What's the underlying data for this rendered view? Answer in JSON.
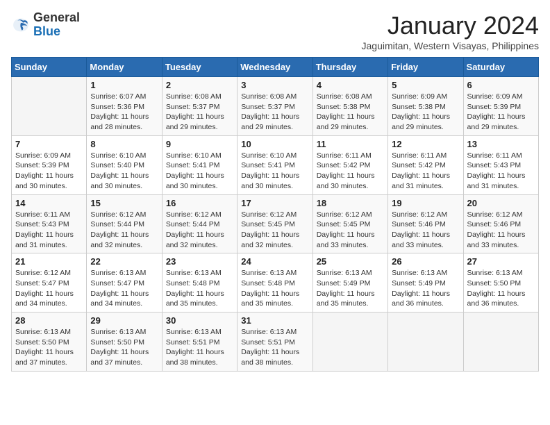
{
  "header": {
    "logo_general": "General",
    "logo_blue": "Blue",
    "month_title": "January 2024",
    "subtitle": "Jaguimitan, Western Visayas, Philippines"
  },
  "days_of_week": [
    "Sunday",
    "Monday",
    "Tuesday",
    "Wednesday",
    "Thursday",
    "Friday",
    "Saturday"
  ],
  "weeks": [
    [
      {
        "day": "",
        "info": ""
      },
      {
        "day": "1",
        "info": "Sunrise: 6:07 AM\nSunset: 5:36 PM\nDaylight: 11 hours\nand 28 minutes."
      },
      {
        "day": "2",
        "info": "Sunrise: 6:08 AM\nSunset: 5:37 PM\nDaylight: 11 hours\nand 29 minutes."
      },
      {
        "day": "3",
        "info": "Sunrise: 6:08 AM\nSunset: 5:37 PM\nDaylight: 11 hours\nand 29 minutes."
      },
      {
        "day": "4",
        "info": "Sunrise: 6:08 AM\nSunset: 5:38 PM\nDaylight: 11 hours\nand 29 minutes."
      },
      {
        "day": "5",
        "info": "Sunrise: 6:09 AM\nSunset: 5:38 PM\nDaylight: 11 hours\nand 29 minutes."
      },
      {
        "day": "6",
        "info": "Sunrise: 6:09 AM\nSunset: 5:39 PM\nDaylight: 11 hours\nand 29 minutes."
      }
    ],
    [
      {
        "day": "7",
        "info": "Sunrise: 6:09 AM\nSunset: 5:39 PM\nDaylight: 11 hours\nand 30 minutes."
      },
      {
        "day": "8",
        "info": "Sunrise: 6:10 AM\nSunset: 5:40 PM\nDaylight: 11 hours\nand 30 minutes."
      },
      {
        "day": "9",
        "info": "Sunrise: 6:10 AM\nSunset: 5:41 PM\nDaylight: 11 hours\nand 30 minutes."
      },
      {
        "day": "10",
        "info": "Sunrise: 6:10 AM\nSunset: 5:41 PM\nDaylight: 11 hours\nand 30 minutes."
      },
      {
        "day": "11",
        "info": "Sunrise: 6:11 AM\nSunset: 5:42 PM\nDaylight: 11 hours\nand 30 minutes."
      },
      {
        "day": "12",
        "info": "Sunrise: 6:11 AM\nSunset: 5:42 PM\nDaylight: 11 hours\nand 31 minutes."
      },
      {
        "day": "13",
        "info": "Sunrise: 6:11 AM\nSunset: 5:43 PM\nDaylight: 11 hours\nand 31 minutes."
      }
    ],
    [
      {
        "day": "14",
        "info": "Sunrise: 6:11 AM\nSunset: 5:43 PM\nDaylight: 11 hours\nand 31 minutes."
      },
      {
        "day": "15",
        "info": "Sunrise: 6:12 AM\nSunset: 5:44 PM\nDaylight: 11 hours\nand 32 minutes."
      },
      {
        "day": "16",
        "info": "Sunrise: 6:12 AM\nSunset: 5:44 PM\nDaylight: 11 hours\nand 32 minutes."
      },
      {
        "day": "17",
        "info": "Sunrise: 6:12 AM\nSunset: 5:45 PM\nDaylight: 11 hours\nand 32 minutes."
      },
      {
        "day": "18",
        "info": "Sunrise: 6:12 AM\nSunset: 5:45 PM\nDaylight: 11 hours\nand 33 minutes."
      },
      {
        "day": "19",
        "info": "Sunrise: 6:12 AM\nSunset: 5:46 PM\nDaylight: 11 hours\nand 33 minutes."
      },
      {
        "day": "20",
        "info": "Sunrise: 6:12 AM\nSunset: 5:46 PM\nDaylight: 11 hours\nand 33 minutes."
      }
    ],
    [
      {
        "day": "21",
        "info": "Sunrise: 6:12 AM\nSunset: 5:47 PM\nDaylight: 11 hours\nand 34 minutes."
      },
      {
        "day": "22",
        "info": "Sunrise: 6:13 AM\nSunset: 5:47 PM\nDaylight: 11 hours\nand 34 minutes."
      },
      {
        "day": "23",
        "info": "Sunrise: 6:13 AM\nSunset: 5:48 PM\nDaylight: 11 hours\nand 35 minutes."
      },
      {
        "day": "24",
        "info": "Sunrise: 6:13 AM\nSunset: 5:48 PM\nDaylight: 11 hours\nand 35 minutes."
      },
      {
        "day": "25",
        "info": "Sunrise: 6:13 AM\nSunset: 5:49 PM\nDaylight: 11 hours\nand 35 minutes."
      },
      {
        "day": "26",
        "info": "Sunrise: 6:13 AM\nSunset: 5:49 PM\nDaylight: 11 hours\nand 36 minutes."
      },
      {
        "day": "27",
        "info": "Sunrise: 6:13 AM\nSunset: 5:50 PM\nDaylight: 11 hours\nand 36 minutes."
      }
    ],
    [
      {
        "day": "28",
        "info": "Sunrise: 6:13 AM\nSunset: 5:50 PM\nDaylight: 11 hours\nand 37 minutes."
      },
      {
        "day": "29",
        "info": "Sunrise: 6:13 AM\nSunset: 5:50 PM\nDaylight: 11 hours\nand 37 minutes."
      },
      {
        "day": "30",
        "info": "Sunrise: 6:13 AM\nSunset: 5:51 PM\nDaylight: 11 hours\nand 38 minutes."
      },
      {
        "day": "31",
        "info": "Sunrise: 6:13 AM\nSunset: 5:51 PM\nDaylight: 11 hours\nand 38 minutes."
      },
      {
        "day": "",
        "info": ""
      },
      {
        "day": "",
        "info": ""
      },
      {
        "day": "",
        "info": ""
      }
    ]
  ]
}
